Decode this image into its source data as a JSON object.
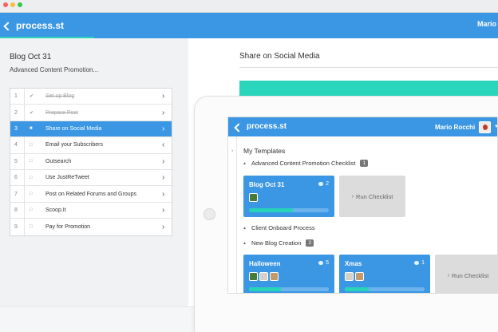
{
  "colors": {
    "primary": "#3b97e3",
    "accent": "#28d4b8",
    "badge": "#777777"
  },
  "app": {
    "logo_text": "process.st",
    "logo_icon": "process-logo-icon",
    "header_user": "Mario"
  },
  "checklist": {
    "title": "Blog Oct 31",
    "subtitle": "Advanced Content Promotion...",
    "tasks": [
      {
        "num": "1",
        "label": "Set up Blog",
        "done": true
      },
      {
        "num": "2",
        "label": "Prepare Post",
        "done": true
      },
      {
        "num": "3",
        "label": "Share on Social Media",
        "done": false,
        "active": true
      },
      {
        "num": "4",
        "label": "Email your Subscribers",
        "done": false
      },
      {
        "num": "5",
        "label": "Outsearch",
        "done": false
      },
      {
        "num": "6",
        "label": "Use JustReTweet",
        "done": false
      },
      {
        "num": "7",
        "label": "Post on Related Forums and Groups",
        "done": false
      },
      {
        "num": "8",
        "label": "Scoop.It",
        "done": false
      },
      {
        "num": "9",
        "label": "Pay for Promotion",
        "done": false
      }
    ]
  },
  "task_detail": {
    "title": "Share on Social Media"
  },
  "templates_app": {
    "logo_text": "process.st",
    "user_name": "Mario Rocchi",
    "section_title": "My Templates",
    "groups": [
      {
        "name": "Advanced Content Promotion Checklist",
        "count": "1"
      },
      {
        "name": "Client Onboard Process",
        "count": ""
      },
      {
        "name": "New Blog Creation",
        "count": "2"
      }
    ],
    "cards": [
      {
        "title": "Blog Oct 31",
        "comments": "2",
        "progress": 0.55
      },
      {
        "title": "Halloween",
        "comments": "5",
        "progress": 0.4
      },
      {
        "title": "Xmas",
        "comments": "1",
        "progress": 0.3
      }
    ],
    "run_label": "Run Checklist"
  }
}
